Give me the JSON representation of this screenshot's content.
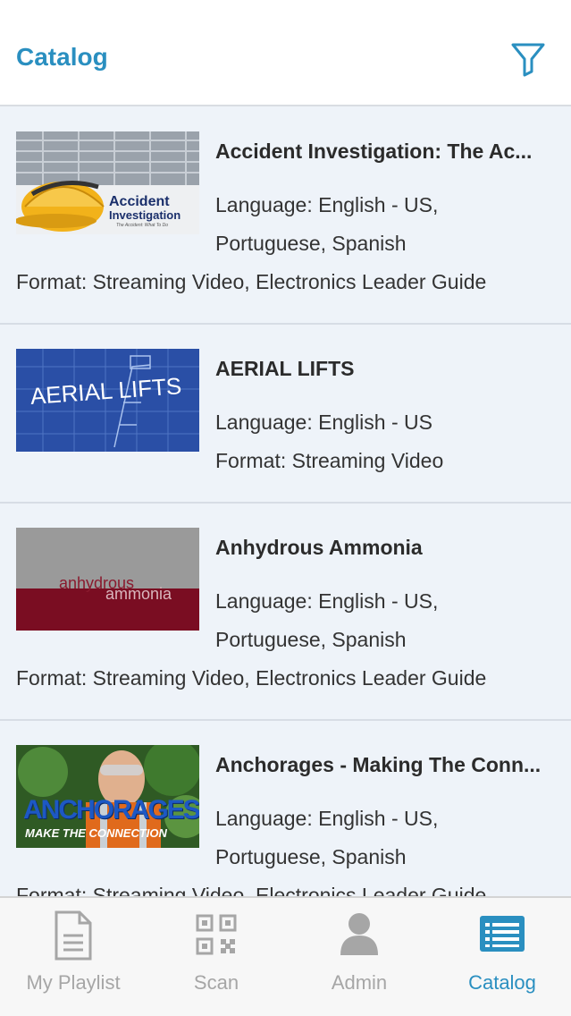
{
  "header": {
    "title": "Catalog",
    "filter_icon": "filter-icon"
  },
  "colors": {
    "accent": "#2a8fc0",
    "list_bg": "#eef3f9",
    "tab_inactive": "#a6a6a6"
  },
  "items": [
    {
      "title": "Accident Investigation: The Ac...",
      "language_line1": "Language: English - US,",
      "language_line2": "Portuguese, Spanish",
      "format": "Format: Streaming Video, Electronics Leader Guide",
      "thumb": {
        "line1": "Accident",
        "line2": "Investigation",
        "tagline": "The Accident: What To Do"
      }
    },
    {
      "title": "AERIAL LIFTS",
      "language_line1": "Language: English - US",
      "format": "Format: Streaming Video",
      "thumb": {
        "text": "AERIAL LIFTS"
      }
    },
    {
      "title": "Anhydrous Ammonia",
      "language_line1": "Language: English - US,",
      "language_line2": "Portuguese, Spanish",
      "format": "Format: Streaming Video, Electronics Leader Guide",
      "thumb": {
        "line1": "anhydrous",
        "line2": "ammonia"
      }
    },
    {
      "title": "Anchorages - Making The Conn...",
      "language_line1": "Language: English - US,",
      "language_line2": "Portuguese, Spanish",
      "format": "Format: Streaming Video, Electronics Leader Guide",
      "thumb": {
        "line1": "ANCHORAGES",
        "line2": "MAKE THE CONNECTION"
      }
    }
  ],
  "tabs": [
    {
      "label": "My Playlist",
      "icon": "document-icon",
      "active": false
    },
    {
      "label": "Scan",
      "icon": "qr-code-icon",
      "active": false
    },
    {
      "label": "Admin",
      "icon": "user-icon",
      "active": false
    },
    {
      "label": "Catalog",
      "icon": "list-icon",
      "active": true
    }
  ]
}
